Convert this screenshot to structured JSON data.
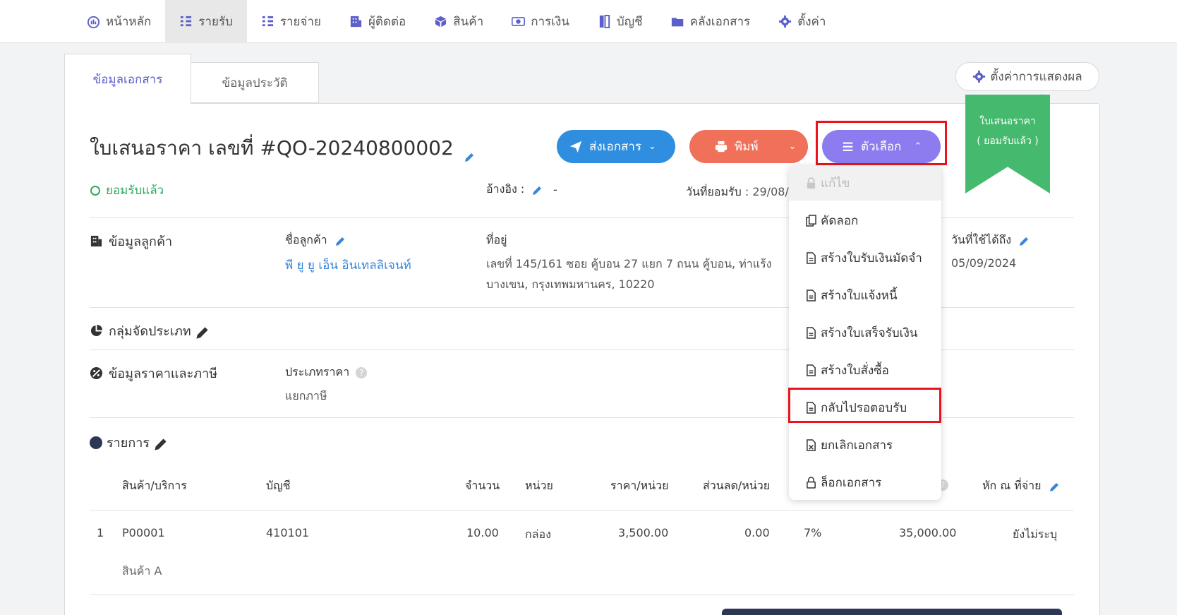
{
  "nav": {
    "items": [
      {
        "label": "หน้าหลัก",
        "icon": "gauge-icon"
      },
      {
        "label": "รายรับ",
        "icon": "income-icon"
      },
      {
        "label": "รายจ่าย",
        "icon": "expense-icon"
      },
      {
        "label": "ผู้ติดต่อ",
        "icon": "building-icon"
      },
      {
        "label": "สินค้า",
        "icon": "box-icon"
      },
      {
        "label": "การเงิน",
        "icon": "money-icon"
      },
      {
        "label": "บัญชี",
        "icon": "ledger-icon"
      },
      {
        "label": "คลังเอกสาร",
        "icon": "folder-icon"
      },
      {
        "label": "ตั้งค่า",
        "icon": "gear-icon"
      }
    ]
  },
  "tabs": {
    "doc": "ข้อมูลเอกสาร",
    "history": "ข้อมูลประวัติ"
  },
  "display_settings": "ตั้งค่าการแสดงผล",
  "ribbon": {
    "line1": "ใบเสนอราคา",
    "line2": "( ยอมรับแล้ว )"
  },
  "document": {
    "title": "ใบเสนอราคา เลขที่ #QO-20240800002",
    "status": "ยอมรับแล้ว",
    "ref_label": "อ้างอิง :",
    "ref_value": "-",
    "accept_label": "วันที่ยอมรับ",
    "accept_value": ": 29/08/"
  },
  "buttons": {
    "send": "ส่งเอกสาร",
    "print": "พิมพ์",
    "options": "ตัวเลือก"
  },
  "dropdown": [
    {
      "label": "แก้ไข",
      "icon": "lock-icon"
    },
    {
      "label": "คัดลอก",
      "icon": "copy-icon"
    },
    {
      "label": "สร้างใบรับเงินมัดจำ",
      "icon": "document-icon"
    },
    {
      "label": "สร้างใบแจ้งหนี้",
      "icon": "document-icon"
    },
    {
      "label": "สร้างใบเสร็จรับเงิน",
      "icon": "document-icon"
    },
    {
      "label": "สร้างใบสั่งซื้อ",
      "icon": "document-icon"
    },
    {
      "label": "กลับไปรอตอบรับ",
      "icon": "document-icon"
    },
    {
      "label": "ยกเลิกเอกสาร",
      "icon": "cancel-document-icon"
    },
    {
      "label": "ล็อกเอกสาร",
      "icon": "unlock-icon"
    }
  ],
  "customer": {
    "section": "ข้อมูลลูกค้า",
    "name_label": "ชื่อลูกค้า",
    "name": "พี ยู ยู เอ็น อินเทลลิเจนท์",
    "address_label": "ที่อยู่",
    "address_line1": "เลขที่ 145/161 ซอย คู้บอน 27 แยก 7 ถนน คู้บอน, ท่าแร้ง",
    "address_line2": "บางเขน, กรุงเทพมหานคร, 10220",
    "valid_label": "วันที่ใช้ได้ถึง",
    "valid_value": "05/09/2024"
  },
  "category": {
    "section": "กลุ่มจัดประเภท"
  },
  "pricing": {
    "section": "ข้อมูลราคาและภาษี",
    "type_label": "ประเภทราคา",
    "type_value": "แยกภาษี"
  },
  "items": {
    "section": "รายการ",
    "headers": {
      "product": "สินค้า/บริการ",
      "account": "บัญชี",
      "qty": "จำนวน",
      "unit": "หน่วย",
      "price": "ราคา/หน่วย",
      "discount": "ส่วนลด/หน่วย",
      "withholding": "หัก ณ ที่จ่าย"
    },
    "rows": [
      {
        "no": "1",
        "code": "P00001",
        "account": "410101",
        "qty": "10.00",
        "unit": "กล่อง",
        "price": "3,500.00",
        "discount": "0.00",
        "vat": "7%",
        "amount": "35,000.00",
        "withholding": "ยังไม่ระบุ",
        "name": "สินค้า A"
      }
    ]
  },
  "colors": {
    "accent": "#5b5fc7",
    "link": "#3a86d8",
    "send": "#2f8ee0",
    "print": "#f0705a",
    "options": "#8c7cf0",
    "status": "#2faa62",
    "ribbon": "#45b96d",
    "highlight": "#e8131c"
  }
}
